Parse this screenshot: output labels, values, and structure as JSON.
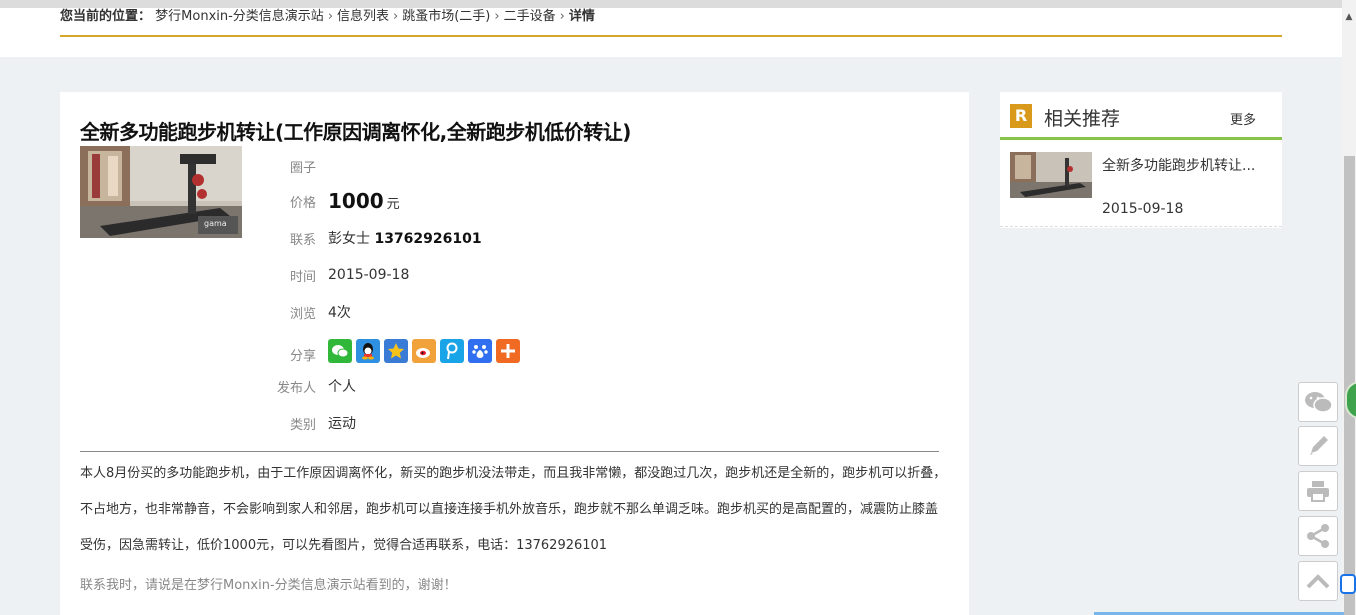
{
  "breadcrumb": {
    "label": "您当前的位置：",
    "items": [
      "梦行Monxin-分类信息演示站",
      "信息列表",
      "跳蚤市场(二手)",
      "二手设备"
    ],
    "current": "详情"
  },
  "listing": {
    "title": "全新多功能跑步机转让(工作原因调离怀化,全新跑步机低价转让)",
    "fields": {
      "circle_label": "圈子",
      "circle_value": "",
      "price_label": "价格",
      "price_value": "1000",
      "price_unit": "元",
      "contact_label": "联系",
      "contact_name": "彭女士",
      "contact_phone": "13762926101",
      "time_label": "时间",
      "time_value": "2015-09-18",
      "views_label": "浏览",
      "views_value": "4次",
      "share_label": "分享",
      "publisher_label": "发布人",
      "publisher_value": "个人",
      "category_label": "类别",
      "category_value": "运动"
    },
    "share_icons": [
      "wechat-icon",
      "qq-icon",
      "qzone-icon",
      "weibo-icon",
      "tencent-weibo-icon",
      "baidu-icon",
      "more-share-icon"
    ],
    "description": "本人8月份买的多功能跑步机，由于工作原因调离怀化，新买的跑步机没法带走，而且我非常懒，都没跑过几次，跑步机还是全新的，跑步机可以折叠，不占地方，也非常静音，不会影响到家人和邻居，跑步机可以直接连接手机外放音乐，跑步就不那么单调乏味。跑步机买的是高配置的，减震防止膝盖受伤，因急需转让，低价1000元，可以先看图片，觉得合适再联系，电话：13762926101",
    "note": "联系我时，请说是在梦行Monxin-分类信息演示站看到的，谢谢！"
  },
  "sidebar": {
    "badge": "R",
    "title": "相关推荐",
    "more": "更多",
    "items": [
      {
        "title": "全新多功能跑步机转让...",
        "date": "2015-09-18"
      }
    ]
  },
  "floating_tools": [
    "wechat-icon",
    "edit-icon",
    "print-icon",
    "share-icon",
    "back-to-top-icon"
  ],
  "colors": {
    "accent_gold": "#d6a62a",
    "sidebar_green": "#8bc34a",
    "badge_orange": "#d99a1b"
  }
}
